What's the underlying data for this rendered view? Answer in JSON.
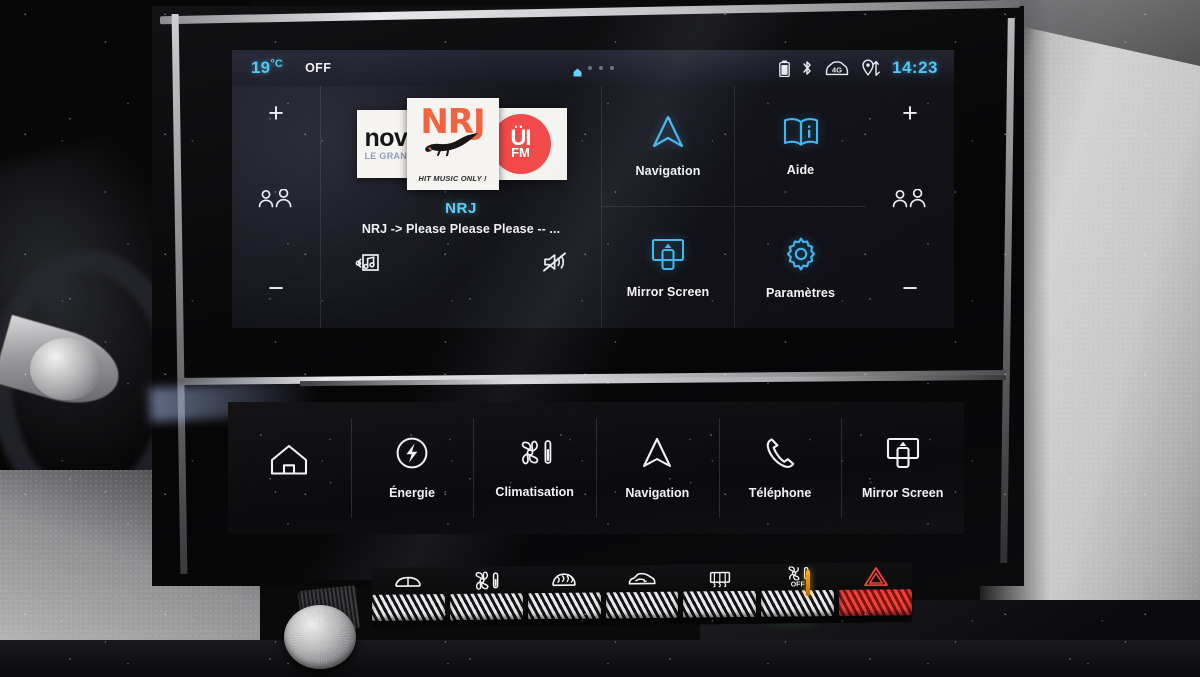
{
  "statusbar": {
    "temperature": "19",
    "temperature_unit": "°C",
    "climate_state": "OFF",
    "clock": "14:23",
    "icons": [
      "battery-icon",
      "bluetooth-icon",
      "4g-car-icon",
      "location-arrows-icon"
    ],
    "network_label": "4G",
    "page_indicator": {
      "home": "home-icon",
      "dots": 3
    }
  },
  "climate_left": {
    "increase": "+",
    "decrease": "−",
    "zone_icon": "dual-occupant-icon"
  },
  "climate_right": {
    "increase": "+",
    "decrease": "−",
    "zone_icon": "dual-occupant-icon"
  },
  "media": {
    "station": "NRJ",
    "track": "NRJ -> Please Please Please -- ...",
    "logos": [
      {
        "name": "nova",
        "text": "nov",
        "subtitle": "LE GRAN"
      },
      {
        "name": "nrj",
        "text": "NRJ",
        "tagline": "HIT MUSIC ONLY !"
      },
      {
        "name": "oui-fm",
        "text": "ÜI",
        "suffix": "FM"
      }
    ],
    "controls": [
      {
        "name": "media-source-button",
        "icon": "music-library-icon"
      },
      {
        "name": "mute-button",
        "icon": "speaker-muted-icon"
      }
    ]
  },
  "tiles": [
    {
      "label": "Navigation",
      "icon": "navigation-arrow-icon"
    },
    {
      "label": "Aide",
      "icon": "help-book-icon"
    },
    {
      "label": "Mirror Screen",
      "icon": "screen-mirror-icon"
    },
    {
      "label": "Paramètres",
      "icon": "gear-icon"
    }
  ],
  "bottom_bar": [
    {
      "label": "",
      "icon": "home-icon",
      "name": "home"
    },
    {
      "label": "Énergie",
      "icon": "energy-bolt-icon",
      "name": "energie"
    },
    {
      "label": "Climatisation",
      "icon": "fan-thermometer-icon",
      "name": "climatisation"
    },
    {
      "label": "Navigation",
      "icon": "navigation-arrow-icon",
      "name": "navigation"
    },
    {
      "label": "Téléphone",
      "icon": "phone-handset-icon",
      "name": "telephone"
    },
    {
      "label": "Mirror Screen",
      "icon": "screen-mirror-icon",
      "name": "mirror-screen"
    }
  ],
  "physical_buttons": [
    {
      "name": "windshield-demist",
      "icon": "car-windshield-icon",
      "label": ""
    },
    {
      "name": "climate-fan",
      "icon": "fan-thermometer-icon",
      "label": ""
    },
    {
      "name": "front-defrost",
      "icon": "front-defrost-icon",
      "label": ""
    },
    {
      "name": "air-recirculation",
      "icon": "air-recirculation-icon",
      "label": ""
    },
    {
      "name": "rear-defrost",
      "icon": "rear-defrost-icon",
      "label": ""
    },
    {
      "name": "climate-off",
      "icon": "fan-off-icon",
      "label": "OFF"
    },
    {
      "name": "hazard-lights",
      "icon": "hazard-triangle-icon",
      "label": ""
    }
  ],
  "colors": {
    "accent_cyan": "#4fc8f5",
    "tile_icon": "#42b7ef",
    "hazard_red": "#f0413b",
    "led_orange": "#ffb023",
    "nrj_orange": "#f0653f",
    "oui_red": "#f24a4a"
  }
}
